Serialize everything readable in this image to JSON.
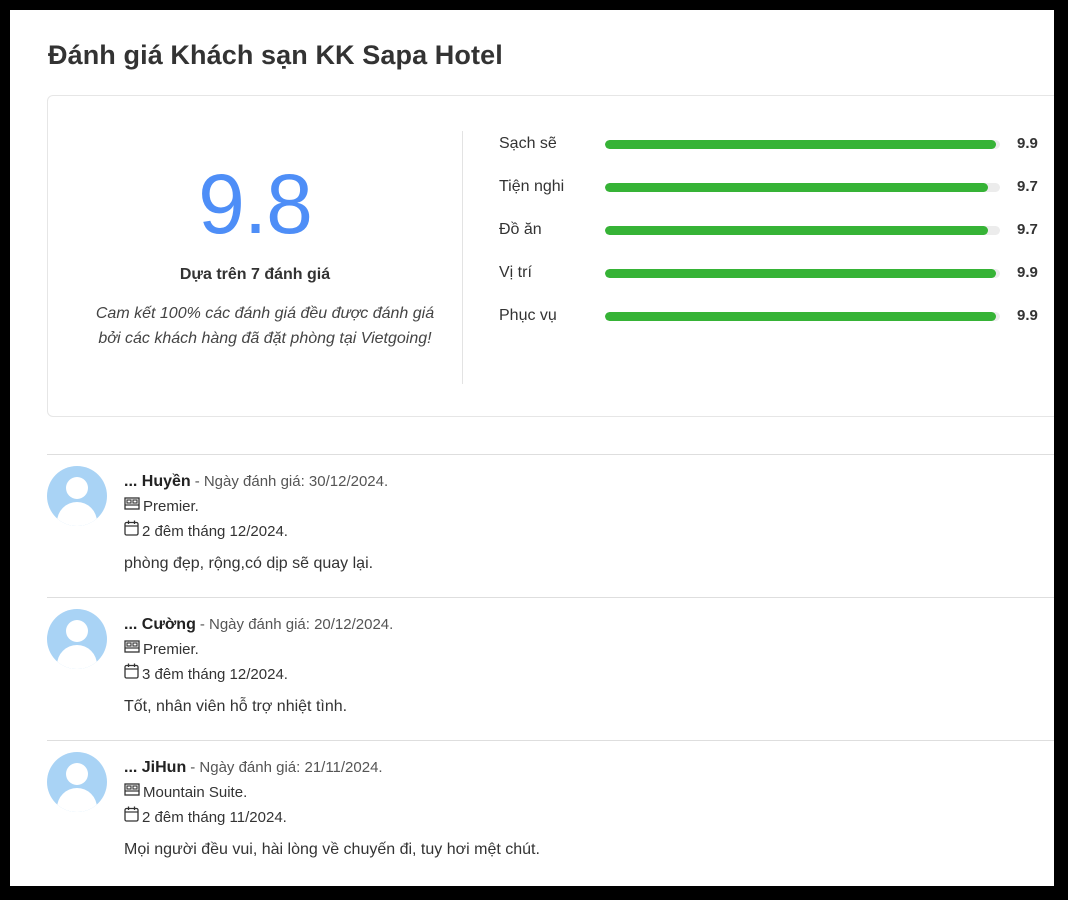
{
  "page": {
    "title": "Đánh giá Khách sạn KK Sapa Hotel"
  },
  "summary": {
    "overall_score": "9.8",
    "based_on": "Dựa trên 7 đánh giá",
    "commitment": "Cam kết 100% các đánh giá đều được đánh giá bởi các khách hàng đã đặt phòng tại Vietgoing!"
  },
  "criteria": [
    {
      "label": "Sạch sẽ",
      "value": "9.9",
      "fraction": 0.99
    },
    {
      "label": "Tiện nghi",
      "value": "9.7",
      "fraction": 0.97
    },
    {
      "label": "Đồ ăn",
      "value": "9.7",
      "fraction": 0.97
    },
    {
      "label": "Vị trí",
      "value": "9.9",
      "fraction": 0.99
    },
    {
      "label": "Phục vụ",
      "value": "9.9",
      "fraction": 0.99
    }
  ],
  "colors": {
    "score": "#4e8ef7",
    "bar_fill": "#36b336",
    "avatar": "#a9d3f5"
  },
  "reviews": [
    {
      "name": "... Huyền",
      "date": "- Ngày đánh giá: 30/12/2024.",
      "room": "Premier.",
      "stay": "2 đêm tháng 12/2024.",
      "text": "phòng đẹp, rộng,có dịp sẽ quay lại."
    },
    {
      "name": "... Cường",
      "date": "- Ngày đánh giá: 20/12/2024.",
      "room": "Premier.",
      "stay": "3 đêm tháng 12/2024.",
      "text": "Tốt, nhân viên hỗ trợ nhiệt tình."
    },
    {
      "name": "... JiHun",
      "date": "- Ngày đánh giá: 21/11/2024.",
      "room": "Mountain Suite.",
      "stay": "2 đêm tháng 11/2024.",
      "text": "Mọi người đều vui, hài lòng về chuyến đi, tuy hơi mệt chút."
    }
  ],
  "icons": {
    "avatar": "user-avatar-icon",
    "room": "bed-icon",
    "stay": "calendar-icon"
  }
}
